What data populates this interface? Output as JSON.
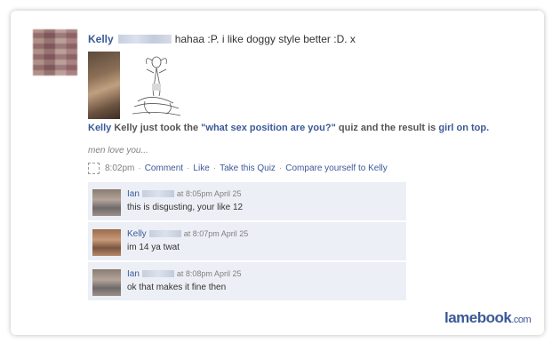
{
  "post": {
    "author": "Kelly",
    "status_text": "hahaa :P. i like doggy style better :D. x",
    "quiz_text_prefix": "Kelly just took the",
    "quiz_name": "\"what sex position are you?\"",
    "quiz_text_middle": "quiz and the result is",
    "quiz_result": "girl on top.",
    "caption": "men love you...",
    "time": "8:02pm",
    "actions": {
      "comment": "Comment",
      "like": "Like",
      "take_quiz": "Take this Quiz",
      "compare": "Compare yourself to Kelly"
    }
  },
  "comments": [
    {
      "author": "Ian",
      "time": "at 8:05pm April 25",
      "text": "this is disgusting, your like 12"
    },
    {
      "author": "Kelly",
      "time": "at 8:07pm April 25",
      "text": "im 14 ya twat"
    },
    {
      "author": "Ian",
      "time": "at 8:08pm April 25",
      "text": "ok that makes it fine then"
    }
  ],
  "brand": {
    "name": "lamebook",
    "tld": ".com"
  },
  "colors": {
    "link": "#3b5998",
    "comment_bg": "#eceff5",
    "meta": "#808080"
  }
}
